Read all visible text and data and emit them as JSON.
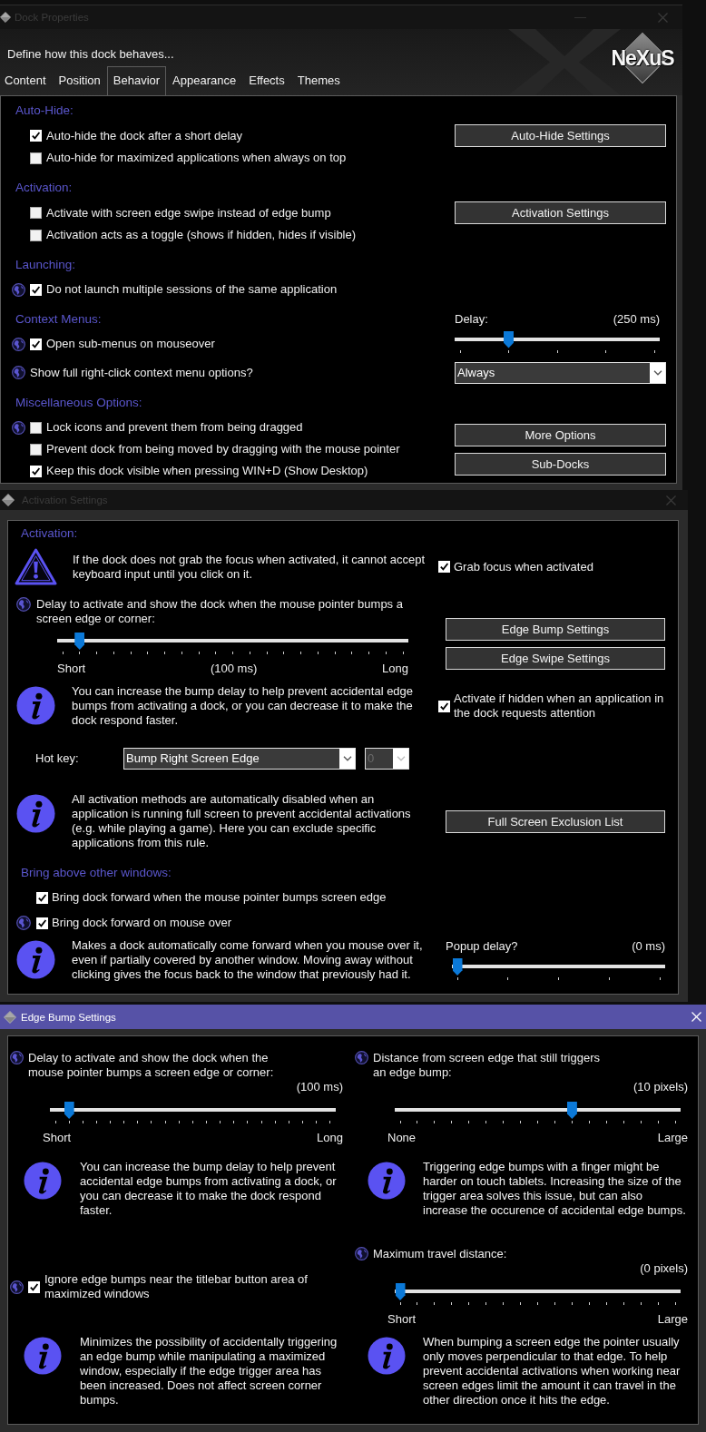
{
  "windows": [
    {
      "kind": "properties",
      "title": "Dock Properties",
      "active": false,
      "banner": {
        "subtitle": "Define how this dock behaves...",
        "logo": "NeXuS"
      },
      "tabs": [
        {
          "label": "Content",
          "selected": false
        },
        {
          "label": "Position",
          "selected": false
        },
        {
          "label": "Behavior",
          "selected": true
        },
        {
          "label": "Appearance",
          "selected": false
        },
        {
          "label": "Effects",
          "selected": false
        },
        {
          "label": "Themes",
          "selected": false
        }
      ],
      "rows": [
        {
          "left": [
            {
              "kind": "heading",
              "text": "Auto-Hide:"
            }
          ]
        },
        {
          "left": [
            {
              "kind": "checkbox",
              "label": "Auto-hide the dock after a short delay",
              "checked": true,
              "globe": false
            }
          ],
          "right": [
            {
              "kind": "button",
              "label": "Auto-Hide Settings"
            }
          ]
        },
        {
          "left": [
            {
              "kind": "checkbox",
              "label": "Auto-hide for maximized applications when always on top",
              "checked": false,
              "globe": false
            }
          ]
        },
        {
          "left": [
            {
              "kind": "heading",
              "text": "Activation:"
            }
          ]
        },
        {
          "left": [
            {
              "kind": "checkbox",
              "label": "Activate with screen edge swipe instead of edge bump",
              "checked": false,
              "globe": false
            }
          ],
          "right": [
            {
              "kind": "button",
              "label": "Activation Settings"
            }
          ]
        },
        {
          "left": [
            {
              "kind": "checkbox",
              "label": "Activation acts as a toggle (shows if hidden, hides if visible)",
              "checked": false,
              "globe": false
            }
          ]
        },
        {
          "left": [
            {
              "kind": "heading",
              "text": "Launching:"
            }
          ]
        },
        {
          "left": [
            {
              "kind": "checkbox",
              "label": "Do not launch multiple sessions of the same application",
              "checked": true,
              "globe": true
            }
          ]
        },
        {
          "left": [
            {
              "kind": "heading",
              "text": "Context Menus:"
            },
            {
              "kind": "checkbox",
              "label": "Open sub-menus on mouseover",
              "checked": true,
              "globe": true
            }
          ],
          "right": [
            {
              "kind": "slider",
              "caption": "Delay:",
              "reading": "(250 ms)",
              "level": 0.25
            }
          ]
        },
        {
          "left": [
            {
              "kind": "text",
              "text": "Show full right-click context menu options?",
              "globe": true
            }
          ],
          "right": [
            {
              "kind": "select",
              "value": "Always"
            }
          ]
        },
        {
          "left": [
            {
              "kind": "heading",
              "text": "Miscellaneous Options:"
            }
          ]
        },
        {
          "left": [
            {
              "kind": "checkbox",
              "label": "Lock icons and prevent them from being dragged",
              "checked": false,
              "globe": true
            },
            {
              "kind": "checkbox",
              "label": "Prevent dock from being moved by dragging with the mouse pointer",
              "checked": false,
              "globe": false
            },
            {
              "kind": "checkbox",
              "label": "Keep this dock visible when pressing WIN+D (Show Desktop)",
              "checked": true,
              "globe": false
            }
          ],
          "right": [
            {
              "kind": "button",
              "label": "More Options"
            },
            {
              "kind": "button",
              "label": "Sub-Docks"
            }
          ]
        }
      ]
    },
    {
      "kind": "dialog",
      "title": "Activation Settings",
      "active": false,
      "rows": [
        {
          "left": [
            {
              "kind": "heading",
              "text": "Activation:"
            }
          ]
        },
        {
          "left": [
            {
              "kind": "warning",
              "text": "If the dock does not grab the focus when activated, it cannot accept keyboard input until you click on it."
            }
          ],
          "right": [
            {
              "kind": "checkbox",
              "label": "Grab focus when activated",
              "checked": true
            }
          ]
        },
        {
          "left": [
            {
              "kind": "text",
              "text": "Delay to activate and show the dock when the mouse pointer bumps a screen edge or corner:",
              "globe": true
            },
            {
              "kind": "slider",
              "level": 0.05,
              "scale_labels": [
                "Short",
                "(100 ms)",
                "Long"
              ]
            }
          ],
          "right": [
            {
              "kind": "button",
              "label": "Edge Bump Settings"
            },
            {
              "kind": "button",
              "label": "Edge Swipe Settings"
            }
          ]
        },
        {
          "left": [
            {
              "kind": "info",
              "text": "You can increase the bump delay to help prevent accidental edge bumps from activating a dock, or you can decrease it to make the dock respond faster."
            }
          ],
          "right": [
            {
              "kind": "checkbox",
              "label": "Activate if hidden when an application in the dock requests attention",
              "checked": true
            }
          ]
        },
        {
          "left": [
            {
              "kind": "hotkey",
              "label": "Hot key:",
              "select": {
                "value": "Bump Right Screen Edge"
              },
              "secondary": {
                "value": "0",
                "disabled": true
              }
            }
          ]
        },
        {
          "left": [
            {
              "kind": "info",
              "text": "All activation methods are automatically disabled when an application is running full screen to prevent accidental activations (e.g. while playing a game). Here you can exclude specific applications from this rule."
            }
          ],
          "right": [
            {
              "kind": "button",
              "label": "Full Screen Exclusion List"
            }
          ]
        },
        {
          "left": [
            {
              "kind": "heading",
              "text": "Bring above other windows:"
            }
          ]
        },
        {
          "left": [
            {
              "kind": "checkbox",
              "label": "Bring dock forward when the mouse pointer bumps screen edge",
              "checked": true,
              "globe": false
            }
          ]
        },
        {
          "left": [
            {
              "kind": "checkbox",
              "label": "Bring dock forward on mouse over",
              "checked": true,
              "globe": true
            }
          ]
        },
        {
          "left": [
            {
              "kind": "info",
              "text": "Makes a dock automatically come forward when you mouse over it, even if partially covered by another window. Moving away without clicking gives the focus back to the window that previously had it."
            }
          ],
          "right": [
            {
              "kind": "slider",
              "caption": "Popup delay?",
              "reading": "(0 ms)",
              "level": 0
            }
          ]
        }
      ]
    },
    {
      "kind": "dialog",
      "title": "Edge Bump Settings",
      "active": true,
      "rows": [
        {
          "left": [
            {
              "kind": "text",
              "text": "Delay to activate and show the dock when the mouse pointer bumps a screen edge or corner:",
              "globe": true
            },
            {
              "kind": "slider",
              "reading": "(100 ms)",
              "level": 0.05,
              "scale_labels": [
                "Short",
                "Long"
              ]
            },
            {
              "kind": "info",
              "text": "You can increase the bump delay to help prevent accidental edge bumps from activating a dock, or you can decrease it to make the dock respond faster."
            }
          ],
          "right": [
            {
              "kind": "text",
              "text": "Distance from screen edge that still triggers an edge bump:",
              "globe": true
            },
            {
              "kind": "slider",
              "reading": "(10 pixels)",
              "level": 0.625,
              "scale_labels": [
                "None",
                "Large"
              ]
            },
            {
              "kind": "info",
              "text": "Triggering edge bumps with a finger might be harder on touch tablets. Increasing the size of the trigger area solves this issue, but can also increase the occurence of accidental edge bumps."
            }
          ]
        },
        {
          "left": [
            {
              "kind": "checkbox",
              "label": "Ignore edge bumps near the titlebar button area of maximized windows",
              "checked": true,
              "globe": true
            }
          ],
          "right": [
            {
              "kind": "text",
              "text": "Maximum travel distance:",
              "globe": true
            },
            {
              "kind": "slider",
              "reading": "(0 pixels)",
              "level": 0,
              "scale_labels": [
                "Short",
                "Large"
              ]
            }
          ]
        },
        {
          "left": [
            {
              "kind": "info",
              "text": "Minimizes the possibility of accidentally triggering an edge bump while manipulating a maximized window, especially if the edge trigger area has been increased. Does not affect screen corner bumps."
            }
          ],
          "right": [
            {
              "kind": "info",
              "text": "When bumping a screen edge the pointer usually only moves perpendicular to that edge. To help prevent accidental activations when working near screen edges limit the amount it can travel in the other direction once it hits the edge."
            }
          ]
        }
      ]
    }
  ]
}
